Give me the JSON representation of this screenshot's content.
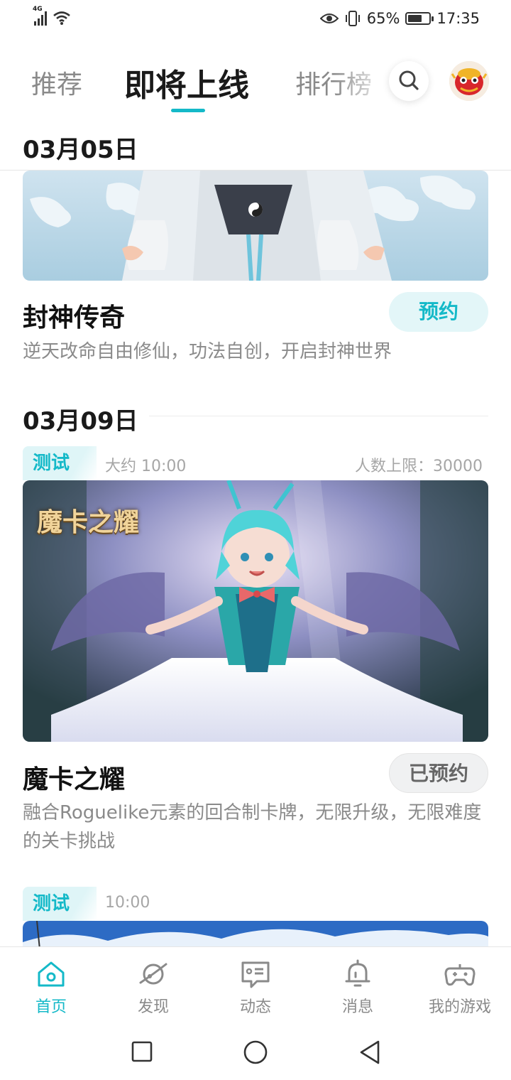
{
  "status_bar": {
    "network": "4G",
    "battery_percent": "65%",
    "battery_level": 0.65,
    "time": "17:35"
  },
  "top_tabs": {
    "items": [
      "推荐",
      "即将上线",
      "排行榜"
    ],
    "active_index": 1
  },
  "colors": {
    "accent": "#14b9c8",
    "text": "#1a1a1a",
    "muted": "#8a8a8a"
  },
  "sections": [
    {
      "date": "03月05日",
      "game": {
        "title": "封神传奇",
        "description": "逆天改命自由修仙，功法自创，开启封神世界",
        "button": "预约"
      }
    },
    {
      "date": "03月09日",
      "game": {
        "tag": "测试",
        "time": "大约 10:00",
        "limit": "人数上限：30000",
        "logo_text": "魔卡之耀",
        "title": "魔卡之耀",
        "description": "融合Roguelike元素的回合制卡牌，无限升级，无限难度的关卡挑战",
        "button": "已预约"
      }
    },
    {
      "game": {
        "tag": "测试",
        "time": "10:00"
      }
    }
  ],
  "bottom_nav": {
    "items": [
      {
        "label": "首页",
        "icon": "home-icon"
      },
      {
        "label": "发现",
        "icon": "planet-icon"
      },
      {
        "label": "动态",
        "icon": "chat-card-icon"
      },
      {
        "label": "消息",
        "icon": "bell-icon"
      },
      {
        "label": "我的游戏",
        "icon": "gamepad-icon"
      }
    ],
    "active_index": 0
  },
  "system_nav": [
    "square-icon",
    "circle-icon",
    "back-triangle-icon"
  ]
}
